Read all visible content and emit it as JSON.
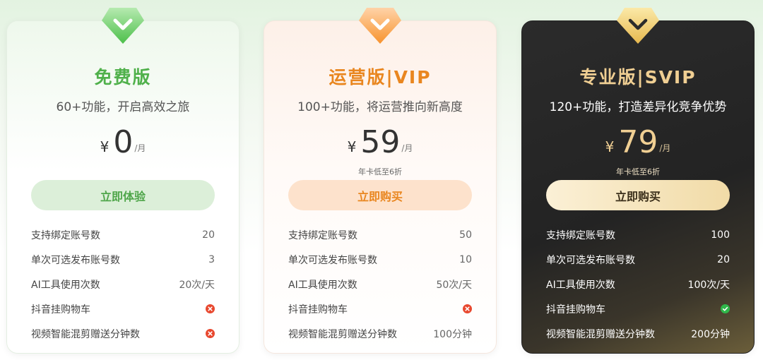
{
  "plans": [
    {
      "id": "free",
      "title": "免费版",
      "subtitle": "60+功能，开启高效之旅",
      "currency": "¥",
      "price": "0",
      "unit": "/月",
      "discount": "",
      "cta": "立即体验",
      "features": [
        {
          "label": "支持绑定账号数",
          "value": "20"
        },
        {
          "label": "单次可选发布账号数",
          "value": "3"
        },
        {
          "label": "AI工具使用次数",
          "value": "20次/天"
        },
        {
          "label": "抖音挂购物车",
          "icon": "cross-icon"
        },
        {
          "label": "视频智能混剪赠送分钟数",
          "icon": "cross-icon"
        }
      ]
    },
    {
      "id": "ops",
      "title": "运营版|VIP",
      "subtitle": "100+功能，将运营推向新高度",
      "currency": "¥",
      "price": "59",
      "unit": "/月",
      "discount": "年卡低至6折",
      "cta": "立即购买",
      "features": [
        {
          "label": "支持绑定账号数",
          "value": "50"
        },
        {
          "label": "单次可选发布账号数",
          "value": "10"
        },
        {
          "label": "AI工具使用次数",
          "value": "50次/天"
        },
        {
          "label": "抖音挂购物车",
          "icon": "cross-icon"
        },
        {
          "label": "视频智能混剪赠送分钟数",
          "value": "100分钟"
        }
      ]
    },
    {
      "id": "pro",
      "title": "专业版|SVIP",
      "subtitle": "120+功能，打造差异化竞争优势",
      "currency": "¥",
      "price": "79",
      "unit": "/月",
      "discount": "年卡低至6折",
      "cta": "立即购买",
      "features": [
        {
          "label": "支持绑定账号数",
          "value": "100"
        },
        {
          "label": "单次可选发布账号数",
          "value": "20"
        },
        {
          "label": "AI工具使用次数",
          "value": "100次/天"
        },
        {
          "label": "抖音挂购物车",
          "icon": "check-icon"
        },
        {
          "label": "视频智能混剪赠送分钟数",
          "value": "200分钟"
        }
      ]
    }
  ],
  "colors": {
    "free_accent": "#4fb04a",
    "ops_accent": "#e9861f",
    "pro_accent": "#f0cf93",
    "cross": "#e8482f",
    "check": "#2fb74a"
  }
}
